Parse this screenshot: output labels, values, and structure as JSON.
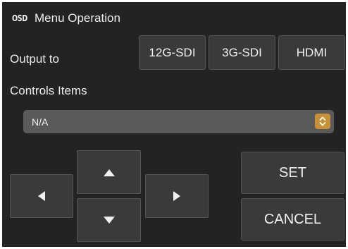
{
  "header": {
    "icon_label": "OSD",
    "title": "Menu Operation"
  },
  "output": {
    "label": "Output to",
    "options": [
      "12G-SDI",
      "3G-SDI",
      "HDMI"
    ]
  },
  "controls": {
    "label": "Controls Items",
    "selected": "N/A"
  },
  "nav": {
    "left_icon": "arrow-left-icon",
    "up_icon": "arrow-up-icon",
    "down_icon": "arrow-down-icon",
    "right_icon": "arrow-right-icon"
  },
  "actions": {
    "set_label": "SET",
    "cancel_label": "CANCEL"
  },
  "colors": {
    "panel_bg": "#232323",
    "button_bg": "#3a3a3a",
    "select_bg": "#5a5a5a",
    "accent": "#c7913a"
  }
}
